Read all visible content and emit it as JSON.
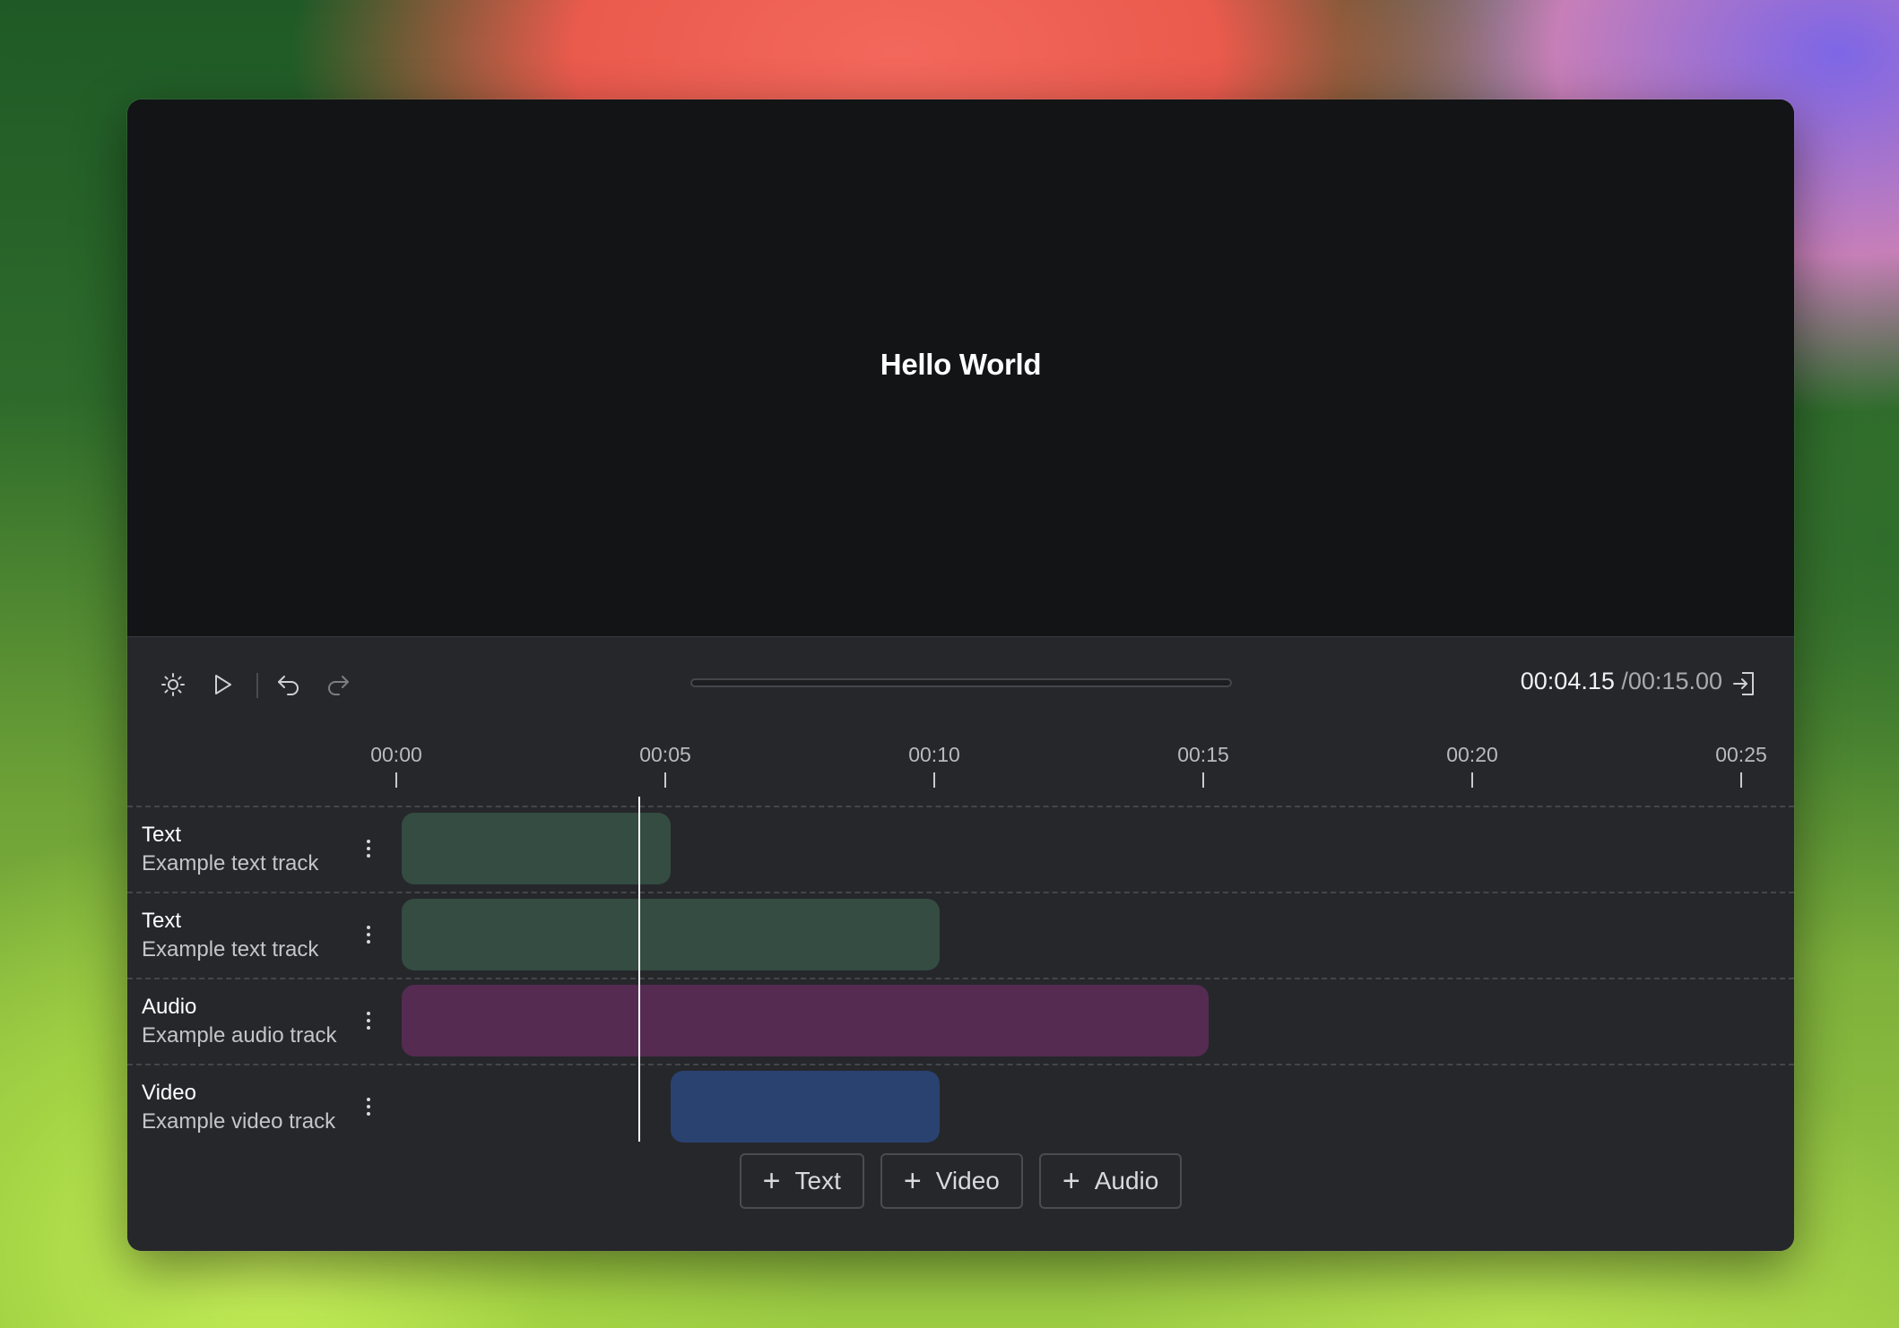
{
  "preview": {
    "text": "Hello World"
  },
  "toolbar": {
    "icons": [
      "sun-icon",
      "play-icon",
      "undo-icon",
      "redo-icon",
      "export-icon"
    ],
    "progress": 0
  },
  "timecode": {
    "current": "00:04.15",
    "separator": " /",
    "total": "00:15.00"
  },
  "ruler": {
    "ticks": [
      "00:00",
      "00:05",
      "00:10",
      "00:15",
      "00:20",
      "00:25"
    ]
  },
  "tracks": [
    {
      "name": "Text",
      "description": "Example text track",
      "clip_color": "#344c42",
      "clip_start_s": 0,
      "clip_end_s": 5
    },
    {
      "name": "Text",
      "description": "Example text track",
      "clip_color": "#344c42",
      "clip_start_s": 0,
      "clip_end_s": 10
    },
    {
      "name": "Audio",
      "description": "Example audio track",
      "clip_color": "#552b52",
      "clip_start_s": 0,
      "clip_end_s": 15
    },
    {
      "name": "Video",
      "description": "Example video track",
      "clip_color": "#2a4270",
      "clip_start_s": 5,
      "clip_end_s": 10
    }
  ],
  "add_buttons": {
    "text": "Text",
    "video": "Video",
    "audio": "Audio"
  },
  "colors": {
    "window_bg": "#131416",
    "editor_bg": "#26272b",
    "playhead": "#ffffff"
  }
}
